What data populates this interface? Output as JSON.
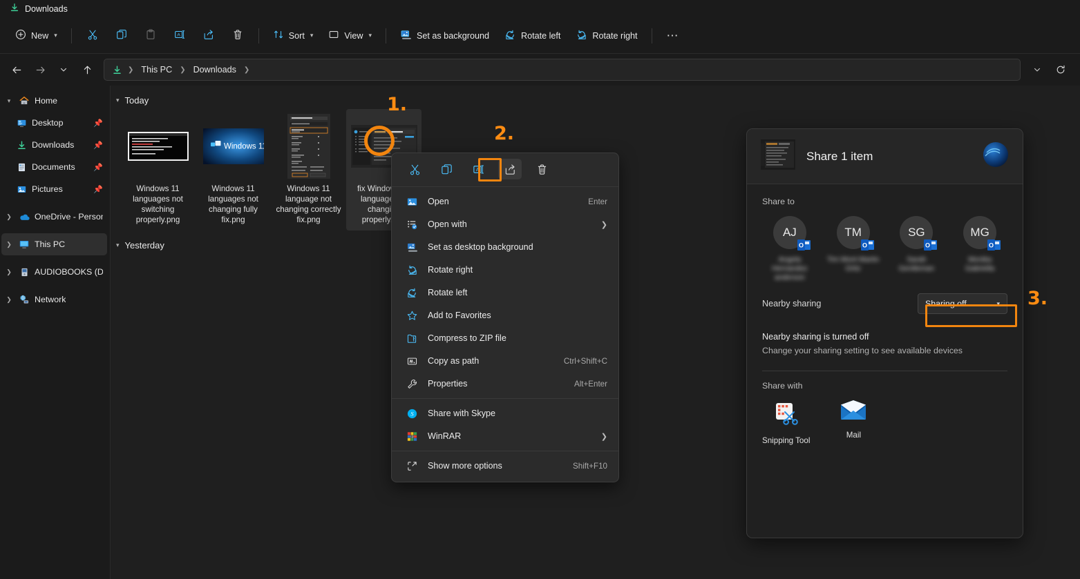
{
  "window": {
    "title": "Downloads",
    "title_icon": "downloads-icon"
  },
  "toolbar": {
    "new_label": "New",
    "cut_label": "Cut",
    "copy_label": "Copy",
    "paste_label": "Paste",
    "rename_label": "Rename",
    "share_label": "Share",
    "delete_label": "Delete",
    "sort_label": "Sort",
    "view_label": "View",
    "set_as_background_label": "Set as background",
    "rotate_left_label": "Rotate left",
    "rotate_right_label": "Rotate right",
    "more_label": "See more"
  },
  "addressbar": {
    "back_label": "Back",
    "forward_label": "Forward",
    "recent_label": "Recent locations",
    "up_label": "Up",
    "crumbs": [
      "This PC",
      "Downloads"
    ],
    "previous_locations_label": "Previous locations",
    "refresh_label": "Refresh"
  },
  "sidebar": {
    "items": [
      {
        "label": "Home",
        "icon": "home-icon",
        "expand": "down",
        "pinned": false,
        "child": false,
        "selected": false
      },
      {
        "label": "Desktop",
        "icon": "desktop-icon",
        "expand": "",
        "pinned": true,
        "child": true,
        "selected": false
      },
      {
        "label": "Downloads",
        "icon": "downloads-icon",
        "expand": "",
        "pinned": true,
        "child": true,
        "selected": false
      },
      {
        "label": "Documents",
        "icon": "documents-icon",
        "expand": "",
        "pinned": true,
        "child": true,
        "selected": false
      },
      {
        "label": "Pictures",
        "icon": "pictures-icon",
        "expand": "",
        "pinned": true,
        "child": true,
        "selected": false
      },
      {
        "label": "OneDrive - Personal",
        "icon": "onedrive-icon",
        "expand": "right",
        "pinned": false,
        "child": false,
        "selected": false
      },
      {
        "label": "This PC",
        "icon": "this-pc-icon",
        "expand": "right",
        "pinned": false,
        "child": false,
        "selected": true
      },
      {
        "label": "AUDIOBOOKS (D:)",
        "icon": "drive-icon",
        "expand": "right",
        "pinned": false,
        "child": false,
        "selected": false
      },
      {
        "label": "Network",
        "icon": "network-icon",
        "expand": "right",
        "pinned": false,
        "child": false,
        "selected": false
      }
    ]
  },
  "content": {
    "groups": [
      {
        "header": "Today"
      },
      {
        "header": "Yesterday"
      }
    ],
    "files": [
      {
        "name": "Windows 11 languages not switching properly.png",
        "thumb": "terminal",
        "selected": false
      },
      {
        "name": "Windows 11 languages not changing fully fix.png",
        "thumb": "windows-logo",
        "selected": false
      },
      {
        "name": "Windows 11 language not changing correctly fix.png",
        "thumb": "settings-dialog",
        "selected": false
      },
      {
        "name": "fix Windows 11 language not changing properly.png",
        "thumb": "explorer-window",
        "selected": true
      }
    ]
  },
  "context_menu": {
    "top_icons": [
      {
        "name": "cut-icon",
        "label": "Cut",
        "highlighted": false
      },
      {
        "name": "copy-icon",
        "label": "Copy",
        "highlighted": false
      },
      {
        "name": "rename-icon",
        "label": "Rename",
        "highlighted": false
      },
      {
        "name": "share-icon",
        "label": "Share",
        "highlighted": true
      },
      {
        "name": "delete-icon",
        "label": "Delete",
        "highlighted": false
      }
    ],
    "items": [
      {
        "label": "Open",
        "accel": "Enter",
        "submenu": false,
        "icon": "image-icon"
      },
      {
        "label": "Open with",
        "accel": "",
        "submenu": true,
        "icon": "open-with-icon"
      },
      {
        "label": "Set as desktop background",
        "accel": "",
        "submenu": false,
        "icon": "desktop-background-icon"
      },
      {
        "label": "Rotate right",
        "accel": "",
        "submenu": false,
        "icon": "rotate-right-icon"
      },
      {
        "label": "Rotate left",
        "accel": "",
        "submenu": false,
        "icon": "rotate-left-icon"
      },
      {
        "label": "Add to Favorites",
        "accel": "",
        "submenu": false,
        "icon": "star-icon"
      },
      {
        "label": "Compress to ZIP file",
        "accel": "",
        "submenu": false,
        "icon": "zip-icon"
      },
      {
        "label": "Copy as path",
        "accel": "Ctrl+Shift+C",
        "submenu": false,
        "icon": "copy-path-icon"
      },
      {
        "label": "Properties",
        "accel": "Alt+Enter",
        "submenu": false,
        "icon": "wrench-icon"
      },
      {
        "divider": true
      },
      {
        "label": "Share with Skype",
        "accel": "",
        "submenu": false,
        "icon": "skype-icon"
      },
      {
        "label": "WinRAR",
        "accel": "",
        "submenu": true,
        "icon": "winrar-icon"
      },
      {
        "divider": true
      },
      {
        "label": "Show more options",
        "accel": "Shift+F10",
        "submenu": false,
        "icon": "show-more-icon"
      }
    ]
  },
  "share_panel": {
    "title": "Share 1 item",
    "share_to_label": "Share to",
    "contacts": [
      {
        "initials": "AJ",
        "name": "Angela Hernandez anderson"
      },
      {
        "initials": "TM",
        "name": "Tim Mont Martin Ortiz"
      },
      {
        "initials": "SG",
        "name": "Sarah Gentleman"
      },
      {
        "initials": "MG",
        "name": "Monika Gabriella"
      }
    ],
    "nearby_sharing_label": "Nearby sharing",
    "nearby_sharing_value": "Sharing off",
    "nearby_note_title": "Nearby sharing is turned off",
    "nearby_note_sub": "Change your sharing setting to see available devices",
    "share_with_label": "Share with",
    "apps": [
      {
        "name": "Snipping Tool",
        "icon": "snipping-tool-icon"
      },
      {
        "name": "Mail",
        "icon": "mail-icon"
      }
    ]
  },
  "annotations": [
    {
      "number": "1."
    },
    {
      "number": "2."
    },
    {
      "number": "3."
    }
  ],
  "colors": {
    "accent_orange": "#f2850f",
    "icon_blue": "#4cc2ff",
    "window_bg": "#1b1b1b",
    "content_bg": "#1f1f1f"
  }
}
